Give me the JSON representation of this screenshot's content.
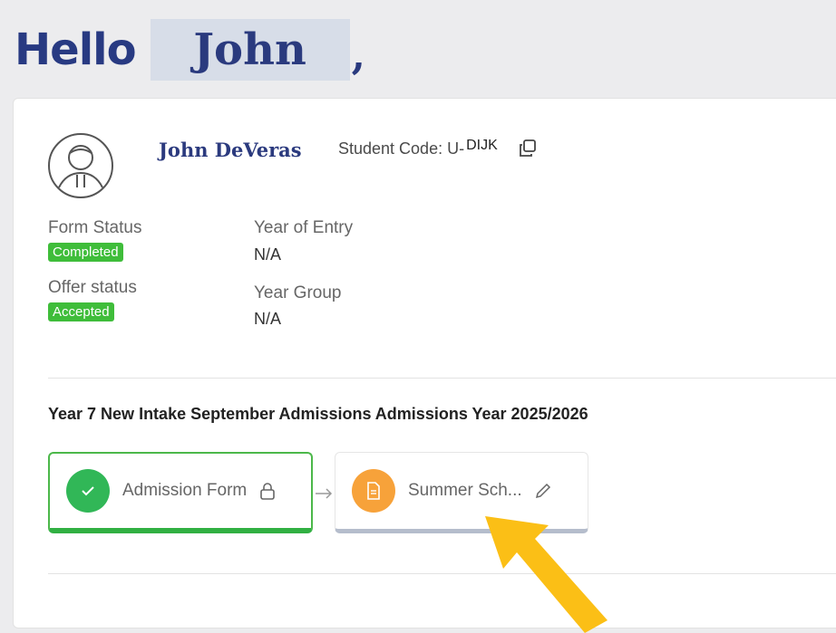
{
  "greeting": {
    "hello": "Hello",
    "name": "John",
    "comma": ","
  },
  "profile": {
    "full_name": "John DeVeras",
    "student_code_label": "Student Code: U-",
    "student_code_value": "DIJK"
  },
  "info": {
    "form_status_label": "Form Status",
    "form_status_value": "Completed",
    "offer_status_label": "Offer status",
    "offer_status_value": "Accepted",
    "year_of_entry_label": "Year of Entry",
    "year_of_entry_value": "N/A",
    "year_group_label": "Year Group",
    "year_group_value": "N/A"
  },
  "admissions": {
    "title": "Year 7 New Intake September Admissions  Admissions Year 2025/2026",
    "steps": [
      {
        "label": "Admission Form",
        "icon": "lock-icon",
        "status": "completed",
        "color": "#31b757"
      },
      {
        "label": "Summer Sch...",
        "icon": "pencil-icon",
        "status": "in-progress",
        "color": "#f7a23a"
      }
    ]
  },
  "colors": {
    "brand": "#283a82",
    "success": "#3fbd3a",
    "warning": "#f7a23a",
    "annotation_arrow": "#fbbf16"
  }
}
